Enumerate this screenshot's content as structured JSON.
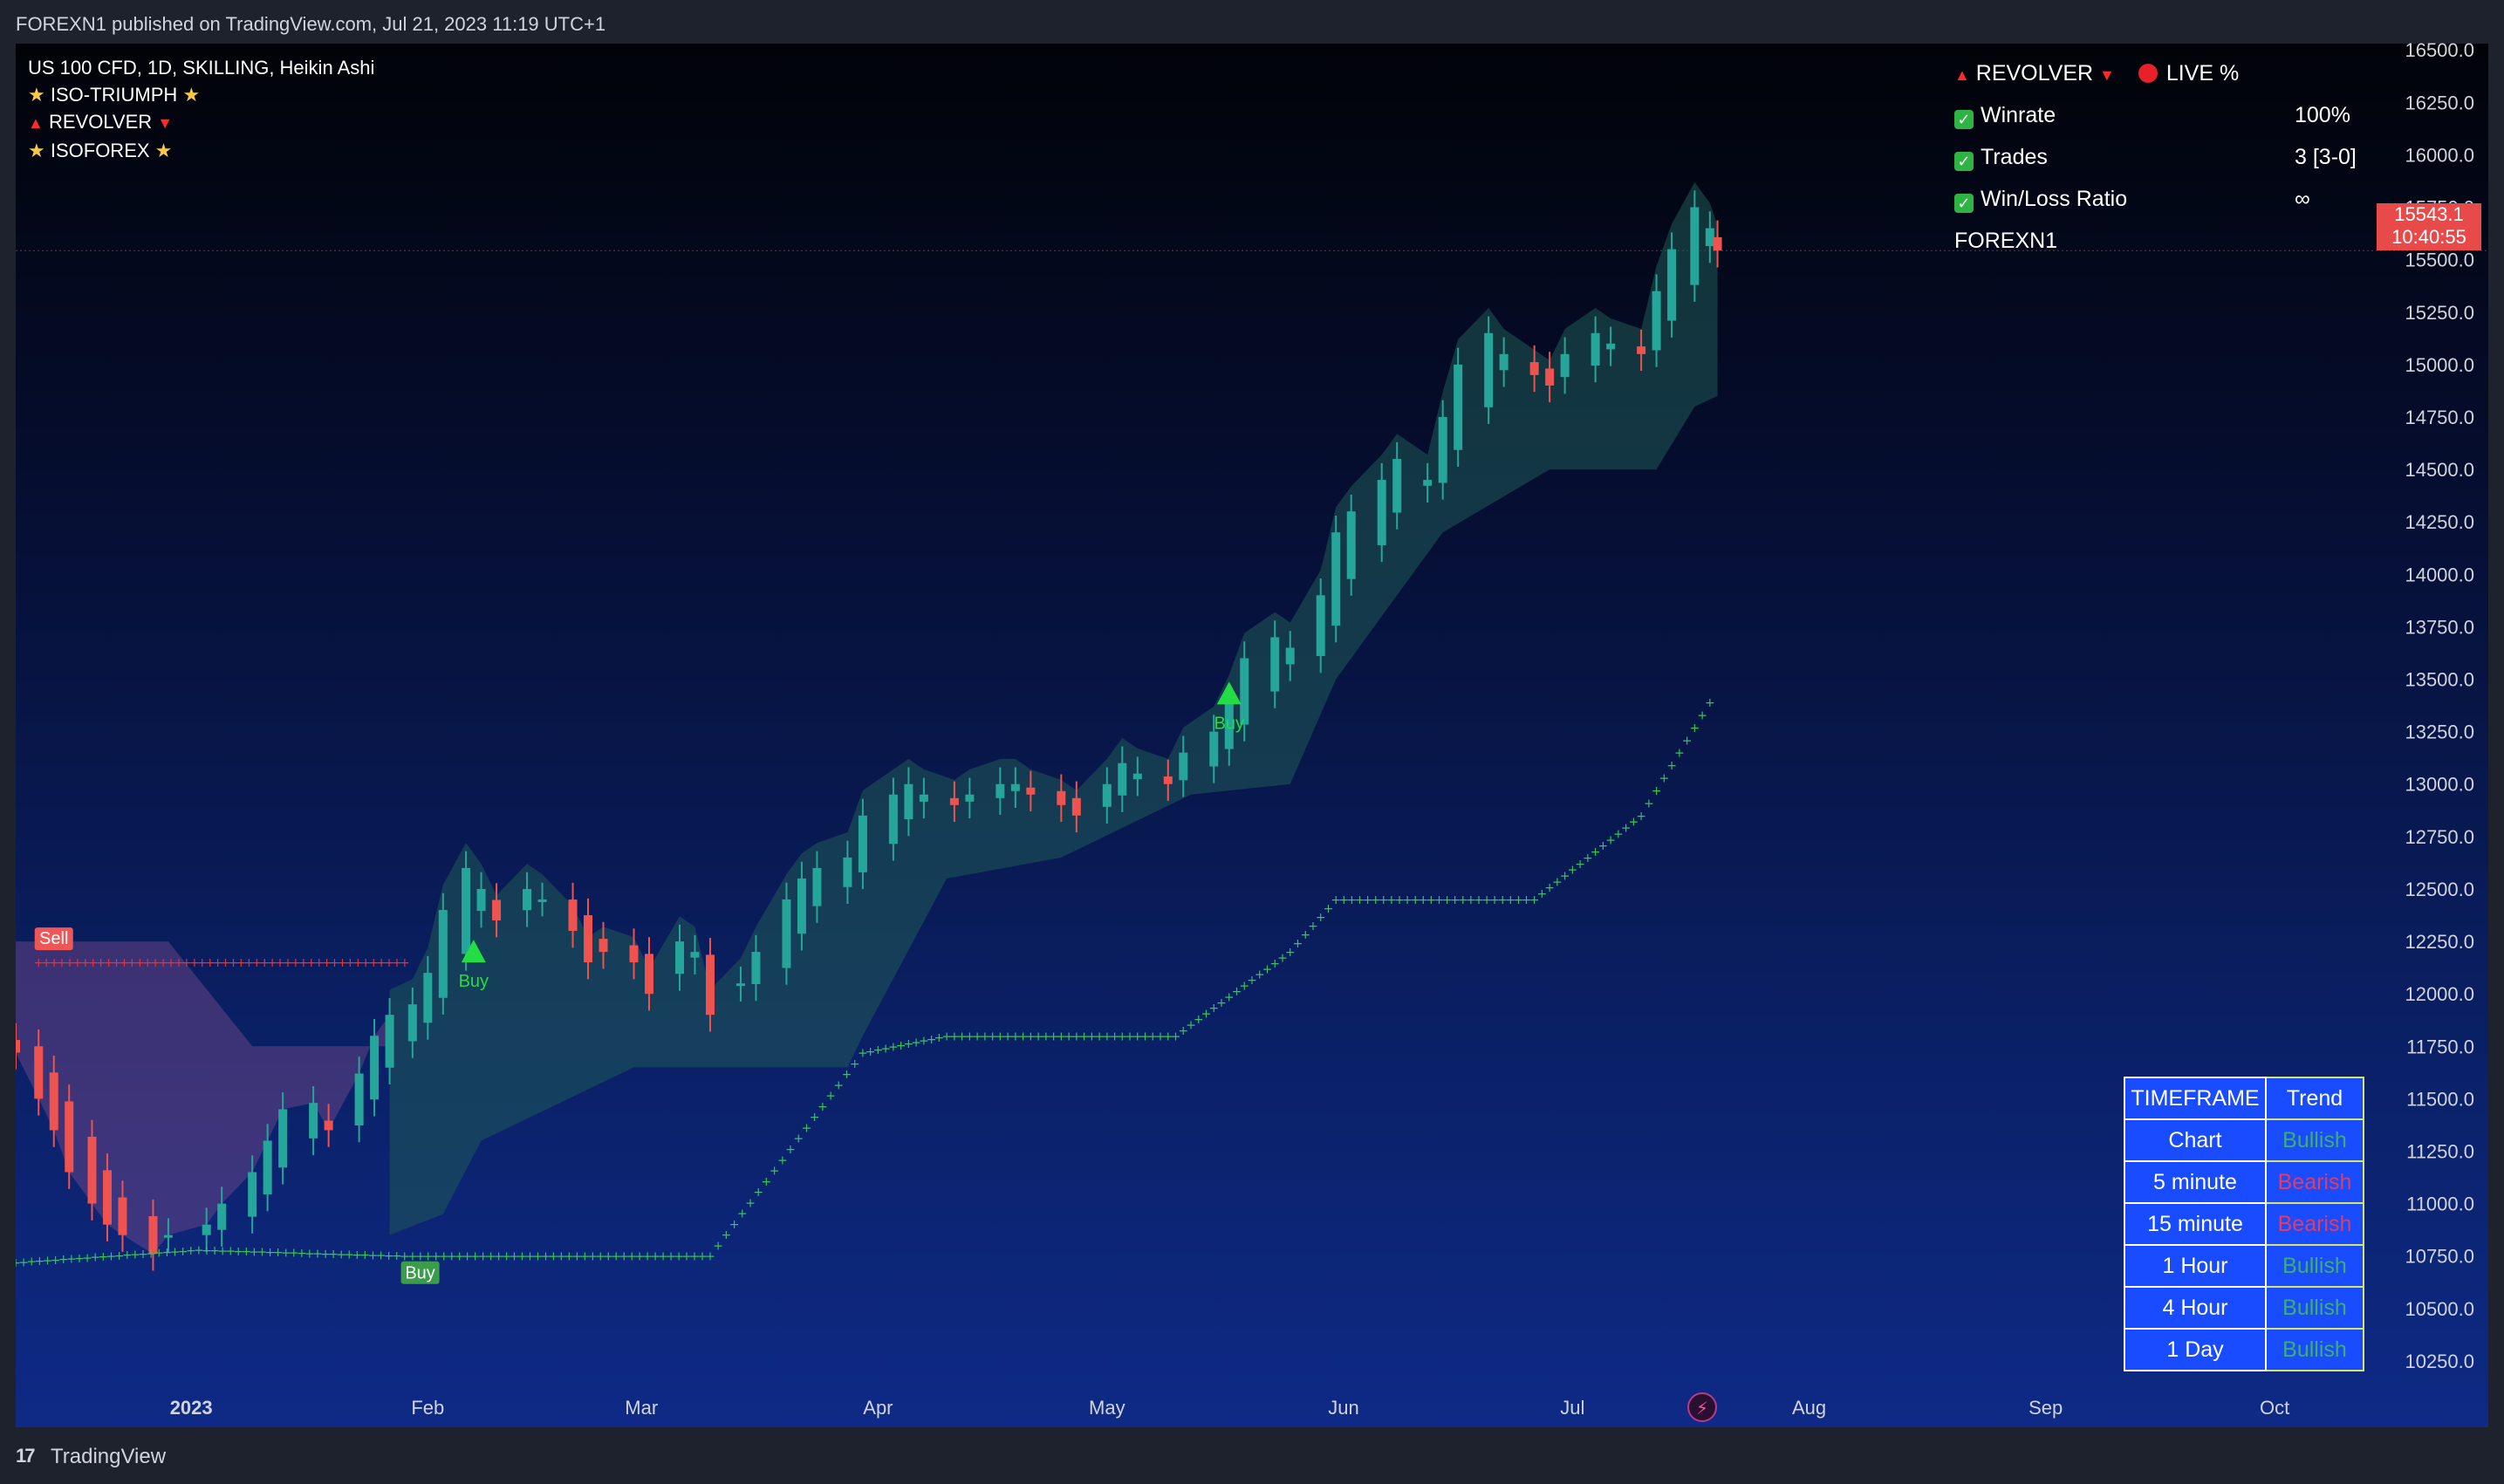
{
  "header": {
    "published": "FOREXN1 published on TradingView.com, Jul 21, 2023 11:19 UTC+1"
  },
  "legend": {
    "symbol": "US 100 CFD, 1D, SKILLING, Heikin Ashi",
    "lines": [
      "ISO-TRIUMPH",
      "REVOLVER",
      "ISOFOREX"
    ]
  },
  "stats": {
    "title": "REVOLVER",
    "live": "LIVE %",
    "rows": [
      {
        "label": "Winrate",
        "value": "100%"
      },
      {
        "label": "Trades",
        "value": "3 [3-0]"
      },
      {
        "label": "Win/Loss Ratio",
        "value": "∞"
      }
    ],
    "author": "FOREXN1"
  },
  "trend_table": {
    "headers": [
      "TIMEFRAME",
      "Trend"
    ],
    "rows": [
      {
        "tf": "Chart",
        "trend": "Bullish"
      },
      {
        "tf": "5 minute",
        "trend": "Bearish"
      },
      {
        "tf": "15 minute",
        "trend": "Bearish"
      },
      {
        "tf": "1 Hour",
        "trend": "Bullish"
      },
      {
        "tf": "4 Hour",
        "trend": "Bullish"
      },
      {
        "tf": "1 Day",
        "trend": "Bullish"
      }
    ]
  },
  "price_tag": {
    "price": "15543.1",
    "countdown": "10:40:55"
  },
  "footer": {
    "brand": "TradingView"
  },
  "colors": {
    "bull": "#26a69a",
    "bear": "#ef5350",
    "signal_buy": "#22dd44",
    "sell_badge": "#f05656",
    "band": "#1d4a4a"
  },
  "chart_data": {
    "type": "candlestick",
    "title": "",
    "y_ticks": [
      10250,
      10500,
      10750,
      11000,
      11250,
      11500,
      11750,
      12000,
      12250,
      12500,
      12750,
      13000,
      13250,
      13500,
      13750,
      14000,
      14250,
      14500,
      14750,
      15000,
      15250,
      15500,
      15750,
      16000,
      16250,
      16500
    ],
    "ylim": [
      10125,
      16530
    ],
    "x_labels": [
      {
        "label": "2023",
        "date": "2023-01-01"
      },
      {
        "label": "Feb",
        "date": "2023-02-01"
      },
      {
        "label": "Mar",
        "date": "2023-03-01"
      },
      {
        "label": "Apr",
        "date": "2023-04-01"
      },
      {
        "label": "May",
        "date": "2023-05-01"
      },
      {
        "label": "Jun",
        "date": "2023-06-01"
      },
      {
        "label": "Jul",
        "date": "2023-07-01"
      },
      {
        "label": "Aug",
        "date": "2023-08-01"
      },
      {
        "label": "Sep",
        "date": "2023-09-01"
      },
      {
        "label": "Oct",
        "date": "2023-10-01"
      }
    ],
    "x_range": [
      "2022-12-09",
      "2023-10-29"
    ],
    "closes": [
      [
        "2022-12-09",
        11720
      ],
      [
        "2022-12-12",
        11500
      ],
      [
        "2022-12-14",
        11350
      ],
      [
        "2022-12-16",
        11150
      ],
      [
        "2022-12-19",
        11000
      ],
      [
        "2022-12-21",
        10900
      ],
      [
        "2022-12-23",
        10850
      ],
      [
        "2022-12-27",
        10760
      ],
      [
        "2022-12-29",
        10850
      ],
      [
        "2023-01-03",
        10900
      ],
      [
        "2023-01-05",
        11000
      ],
      [
        "2023-01-09",
        11150
      ],
      [
        "2023-01-11",
        11300
      ],
      [
        "2023-01-13",
        11450
      ],
      [
        "2023-01-17",
        11480
      ],
      [
        "2023-01-19",
        11350
      ],
      [
        "2023-01-23",
        11620
      ],
      [
        "2023-01-25",
        11800
      ],
      [
        "2023-01-27",
        11900
      ],
      [
        "2023-01-30",
        11950
      ],
      [
        "2023-02-01",
        12100
      ],
      [
        "2023-02-03",
        12400
      ],
      [
        "2023-02-06",
        12600
      ],
      [
        "2023-02-08",
        12500
      ],
      [
        "2023-02-10",
        12350
      ],
      [
        "2023-02-14",
        12500
      ],
      [
        "2023-02-16",
        12450
      ],
      [
        "2023-02-20",
        12300
      ],
      [
        "2023-02-22",
        12150
      ],
      [
        "2023-02-24",
        12200
      ],
      [
        "2023-02-28",
        12150
      ],
      [
        "2023-03-02",
        12000
      ],
      [
        "2023-03-06",
        12250
      ],
      [
        "2023-03-08",
        12200
      ],
      [
        "2023-03-10",
        11900
      ],
      [
        "2023-03-14",
        12050
      ],
      [
        "2023-03-16",
        12200
      ],
      [
        "2023-03-20",
        12450
      ],
      [
        "2023-03-22",
        12550
      ],
      [
        "2023-03-24",
        12600
      ],
      [
        "2023-03-28",
        12650
      ],
      [
        "2023-03-30",
        12850
      ],
      [
        "2023-04-03",
        12950
      ],
      [
        "2023-04-05",
        13000
      ],
      [
        "2023-04-07",
        12950
      ],
      [
        "2023-04-11",
        12900
      ],
      [
        "2023-04-13",
        12950
      ],
      [
        "2023-04-17",
        13000
      ],
      [
        "2023-04-19",
        13000
      ],
      [
        "2023-04-21",
        12950
      ],
      [
        "2023-04-25",
        12900
      ],
      [
        "2023-04-27",
        12850
      ],
      [
        "2023-05-01",
        13000
      ],
      [
        "2023-05-03",
        13100
      ],
      [
        "2023-05-05",
        13050
      ],
      [
        "2023-05-09",
        13000
      ],
      [
        "2023-05-11",
        13150
      ],
      [
        "2023-05-15",
        13250
      ],
      [
        "2023-05-17",
        13400
      ],
      [
        "2023-05-19",
        13600
      ],
      [
        "2023-05-23",
        13700
      ],
      [
        "2023-05-25",
        13650
      ],
      [
        "2023-05-29",
        13900
      ],
      [
        "2023-05-31",
        14200
      ],
      [
        "2023-06-02",
        14300
      ],
      [
        "2023-06-06",
        14450
      ],
      [
        "2023-06-08",
        14550
      ],
      [
        "2023-06-12",
        14450
      ],
      [
        "2023-06-14",
        14750
      ],
      [
        "2023-06-16",
        15000
      ],
      [
        "2023-06-20",
        15150
      ],
      [
        "2023-06-22",
        15050
      ],
      [
        "2023-06-26",
        14950
      ],
      [
        "2023-06-28",
        14900
      ],
      [
        "2023-06-30",
        15050
      ],
      [
        "2023-07-04",
        15150
      ],
      [
        "2023-07-06",
        15100
      ],
      [
        "2023-07-10",
        15050
      ],
      [
        "2023-07-12",
        15350
      ],
      [
        "2023-07-14",
        15550
      ],
      [
        "2023-07-17",
        15750
      ],
      [
        "2023-07-19",
        15650
      ],
      [
        "2023-07-20",
        15543
      ]
    ],
    "supertrend_bands": [
      [
        "2022-12-09",
        12250,
        12250
      ],
      [
        "2023-01-25",
        11750,
        11750
      ],
      [
        "2023-01-27",
        11450,
        10850
      ],
      [
        "2023-02-03",
        11650,
        10950
      ],
      [
        "2023-02-08",
        11650,
        11300
      ],
      [
        "2023-02-28",
        11650,
        11650
      ],
      [
        "2023-03-28",
        11650,
        11650
      ],
      [
        "2023-03-30",
        11800,
        11800
      ],
      [
        "2023-04-10",
        12550,
        12550
      ],
      [
        "2023-04-25",
        12650,
        12650
      ],
      [
        "2023-05-12",
        12950,
        12950
      ],
      [
        "2023-05-25",
        13000,
        13000
      ],
      [
        "2023-05-31",
        13500,
        13500
      ],
      [
        "2023-06-06",
        13800,
        13800
      ],
      [
        "2023-06-14",
        14200,
        14200
      ],
      [
        "2023-06-28",
        14500,
        14500
      ],
      [
        "2023-07-12",
        14500,
        14500
      ],
      [
        "2023-07-17",
        14800,
        14800
      ],
      [
        "2023-07-20",
        14850,
        14850
      ]
    ],
    "trailing_dots_red": [
      [
        "2022-12-12",
        12150
      ],
      [
        "2023-01-30",
        12150
      ]
    ],
    "trailing_dots_green": [
      [
        "2022-12-09",
        10720
      ],
      [
        "2023-01-02",
        10780
      ],
      [
        "2023-01-30",
        10750
      ],
      [
        "2023-03-10",
        10750
      ],
      [
        "2023-03-30",
        11720
      ],
      [
        "2023-04-10",
        11800
      ],
      [
        "2023-04-25",
        11800
      ],
      [
        "2023-05-10",
        11800
      ],
      [
        "2023-05-25",
        12200
      ],
      [
        "2023-05-31",
        12450
      ],
      [
        "2023-06-26",
        12450
      ],
      [
        "2023-07-10",
        12850
      ],
      [
        "2023-07-20",
        13450
      ]
    ],
    "signals": [
      {
        "type": "Sell",
        "date": "2022-12-14",
        "price": 12250
      },
      {
        "type": "Buy",
        "date": "2023-01-31",
        "price": 10700
      },
      {
        "type": "Buy",
        "date": "2023-02-07",
        "price": 12150
      },
      {
        "type": "Buy",
        "date": "2023-05-17",
        "price": 13380
      }
    ],
    "last_price": 15543.1
  }
}
